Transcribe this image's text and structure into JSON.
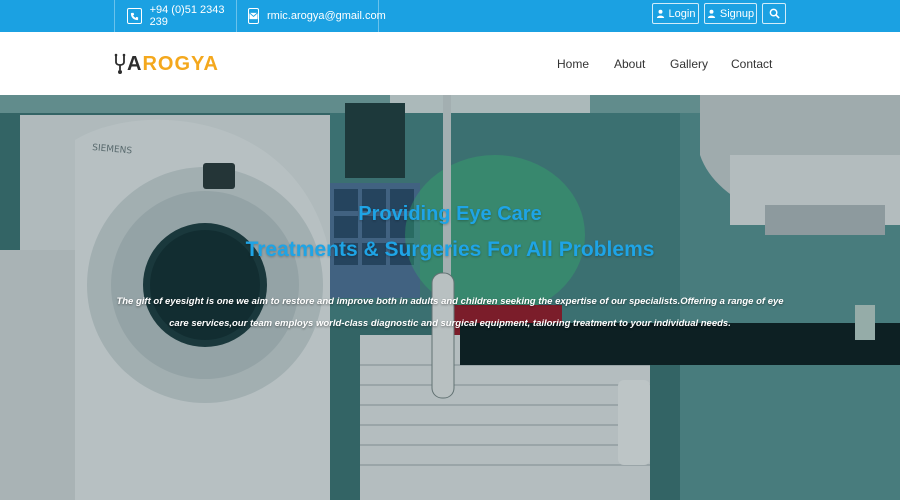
{
  "topbar": {
    "phone": "+94 (0)51 2343 239",
    "email": "rmic.arogya@gmail.com",
    "login_label": "Login",
    "signup_label": "Signup",
    "icons": {
      "phone": "phone-icon",
      "email": "email-icon",
      "user": "user-icon",
      "search": "search-icon"
    }
  },
  "brand": {
    "logo_prefix": "A",
    "logo_r": "R",
    "logo_o": "O",
    "logo_suffix": "GYA",
    "logo_icon": "stethoscope-icon",
    "colors": {
      "dark": "#2d2d2d",
      "accent": "#f4a81d"
    }
  },
  "nav": {
    "items": [
      {
        "label": "Home"
      },
      {
        "label": "About"
      },
      {
        "label": "Gallery"
      },
      {
        "label": "Contact"
      }
    ]
  },
  "hero": {
    "title_line1": "Providing Eye Care",
    "title_line2": "Treatments & Surgeries For All Problems",
    "description": "The gift of eyesight is one we aim to restore and improve both in adults and children seeking the expertise of our specialists.Offering a range of eye care services,our team employs world-class diagnostic and surgical equipment, tailoring treatment to your individual needs.",
    "scanner_brand": "SIEMENS",
    "colors": {
      "title": "#1ea4e6",
      "topbar": "#1ba1e2"
    }
  }
}
